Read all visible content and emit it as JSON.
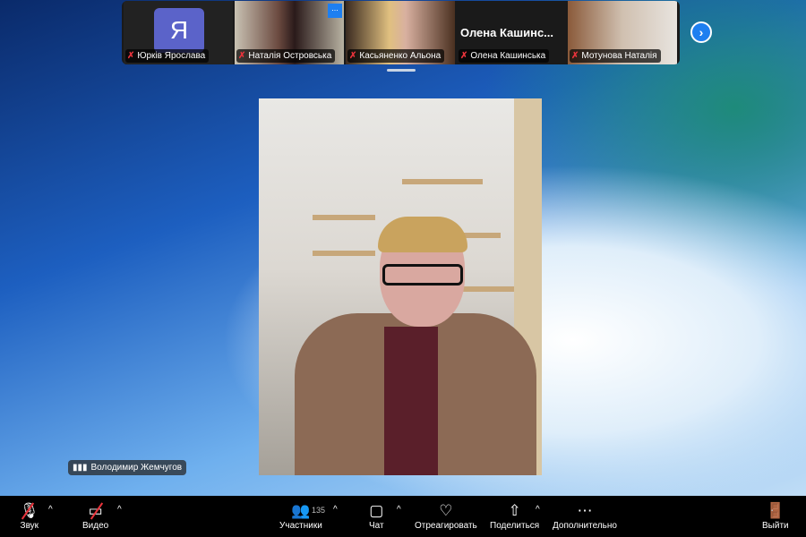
{
  "participants_strip": [
    {
      "name": "Юрків Ярослава",
      "avatar_letter": "Я",
      "muted": true
    },
    {
      "name": "Наталія Островська",
      "muted": true,
      "menu": "..."
    },
    {
      "name": "Касьяненко Альона",
      "muted": true
    },
    {
      "name": "Олена Кашинська",
      "display_title": "Олена  Кашинс...",
      "muted": true
    },
    {
      "name": "Мотунова Наталія",
      "muted": true
    }
  ],
  "active_speaker": {
    "name": "Володимир Жемчугов"
  },
  "toolbar": {
    "audio": "Звук",
    "video": "Видео",
    "participants": "Участники",
    "participants_count": "135",
    "chat": "Чат",
    "react": "Отреагировать",
    "share": "Поделиться",
    "more": "Дополнительно",
    "leave": "Выйти"
  },
  "colors": {
    "accent": "#1e7ff0",
    "muted": "#e8333b",
    "toolbar": "#000000"
  }
}
